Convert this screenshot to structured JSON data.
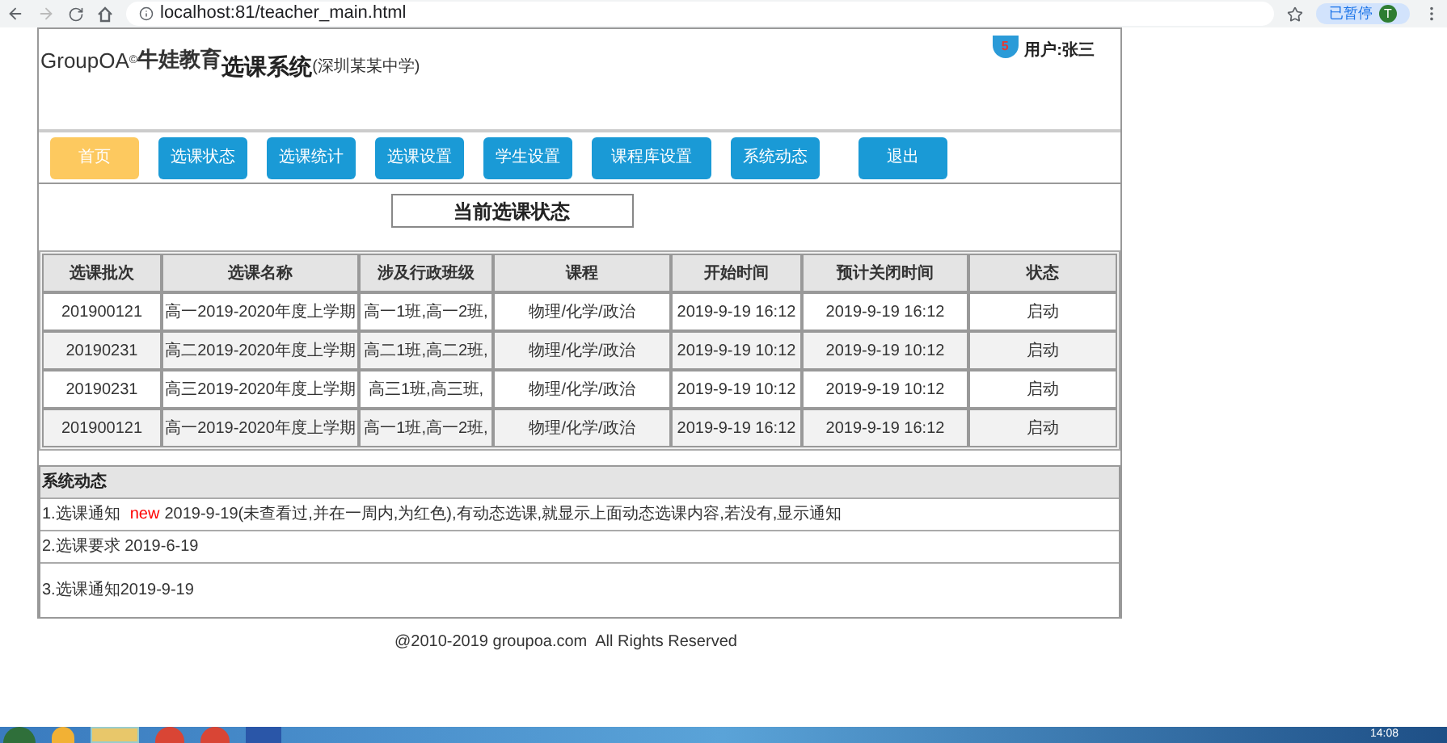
{
  "browser": {
    "url": "localhost:81/teacher_main.html",
    "profile_badge": "已暂停",
    "avatar_letter": "T"
  },
  "header": {
    "brand": "GroupOA",
    "brand_mark": "©",
    "brand_cn": "牛娃教育",
    "system_title": "选课系统",
    "school": "(深圳某某中学)",
    "notification_count": "5",
    "user": "用户:张三"
  },
  "nav": [
    {
      "label": "首页",
      "selected": true
    },
    {
      "label": "选课状态",
      "selected": false
    },
    {
      "label": "选课统计",
      "selected": false
    },
    {
      "label": "选课设置",
      "selected": false
    },
    {
      "label": "学生设置",
      "selected": false
    },
    {
      "label": "课程库设置",
      "selected": false
    },
    {
      "label": "系统动态",
      "selected": false
    },
    {
      "label": "退出",
      "selected": false
    }
  ],
  "section_title": "当前选课状态",
  "table": {
    "columns": [
      "选课批次",
      "选课名称",
      "涉及行政班级",
      "课程",
      "开始时间",
      "预计关闭时间",
      "状态"
    ],
    "rows": [
      [
        "201900121",
        "高一2019-2020年度上学期",
        "高一1班,高一2班,",
        "物理/化学/政治",
        "2019-9-19 16:12",
        "2019-9-19 16:12",
        "启动"
      ],
      [
        "20190231",
        "高二2019-2020年度上学期",
        "高二1班,高二2班,",
        "物理/化学/政治",
        "2019-9-19 10:12",
        "2019-9-19 10:12",
        "启动"
      ],
      [
        "20190231",
        "高三2019-2020年度上学期",
        "高三1班,高三班,",
        "物理/化学/政治",
        "2019-9-19 10:12",
        "2019-9-19 10:12",
        "启动"
      ],
      [
        "201900121",
        "高一2019-2020年度上学期",
        "高一1班,高一2班,",
        "物理/化学/政治",
        "2019-9-19 16:12",
        "2019-9-19 16:12",
        "启动"
      ]
    ]
  },
  "news": {
    "title": "系统动态",
    "items": [
      {
        "title": "1.选课通知",
        "badge": "new",
        "detail": "2019-9-19(未查看过,并在一周内,为红色),有动态选课,就显示上面动态选课内容,若没有,显示通知"
      },
      {
        "title": "2.选课要求",
        "detail": "2019-6-19"
      },
      {
        "title": "3.选课通知2019-9-19"
      }
    ]
  },
  "footer": "@2010-2019 groupoa.com  All Rights Reserved",
  "taskbar": {
    "clock": "14:08"
  }
}
